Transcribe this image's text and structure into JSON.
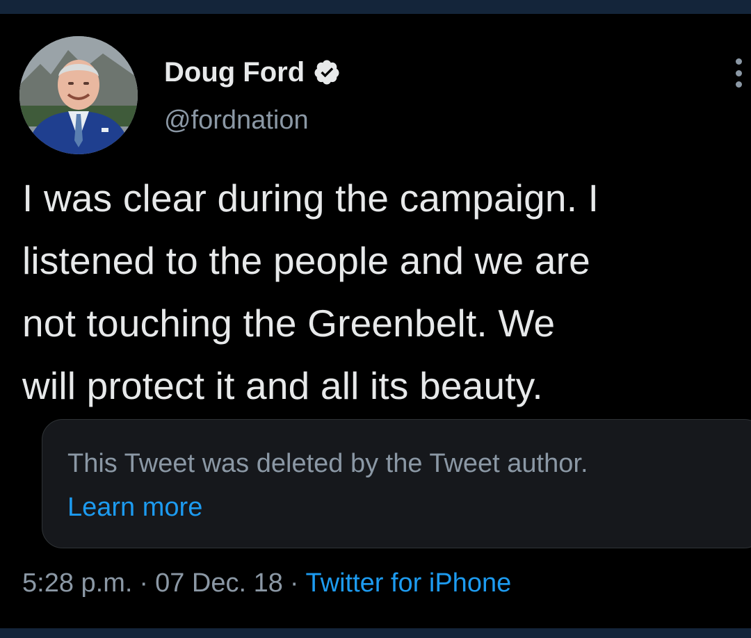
{
  "author": {
    "display_name": "Doug Ford",
    "handle": "@fordnation",
    "verified": true,
    "avatar_icon": "profile-photo"
  },
  "tweet": {
    "lines": [
      "I was clear during the campaign. I",
      "listened to the people and we are",
      "not touching the Greenbelt. We",
      "will protect it and all its beauty."
    ]
  },
  "quoted": {
    "deleted_message": "This Tweet was deleted by the Tweet author.",
    "learn_more": "Learn more"
  },
  "meta": {
    "time": "5:28 p.m.",
    "separator": "·",
    "date": "07 Dec. 18",
    "source": "Twitter for iPhone"
  },
  "icons": {
    "more": "more-vertical-icon",
    "verified": "verified-badge-icon"
  },
  "colors": {
    "background": "#000000",
    "text": "#e7e9ea",
    "secondary": "#8b98a5",
    "accent": "#1d9bf0",
    "edge_bar": "#14253a"
  }
}
